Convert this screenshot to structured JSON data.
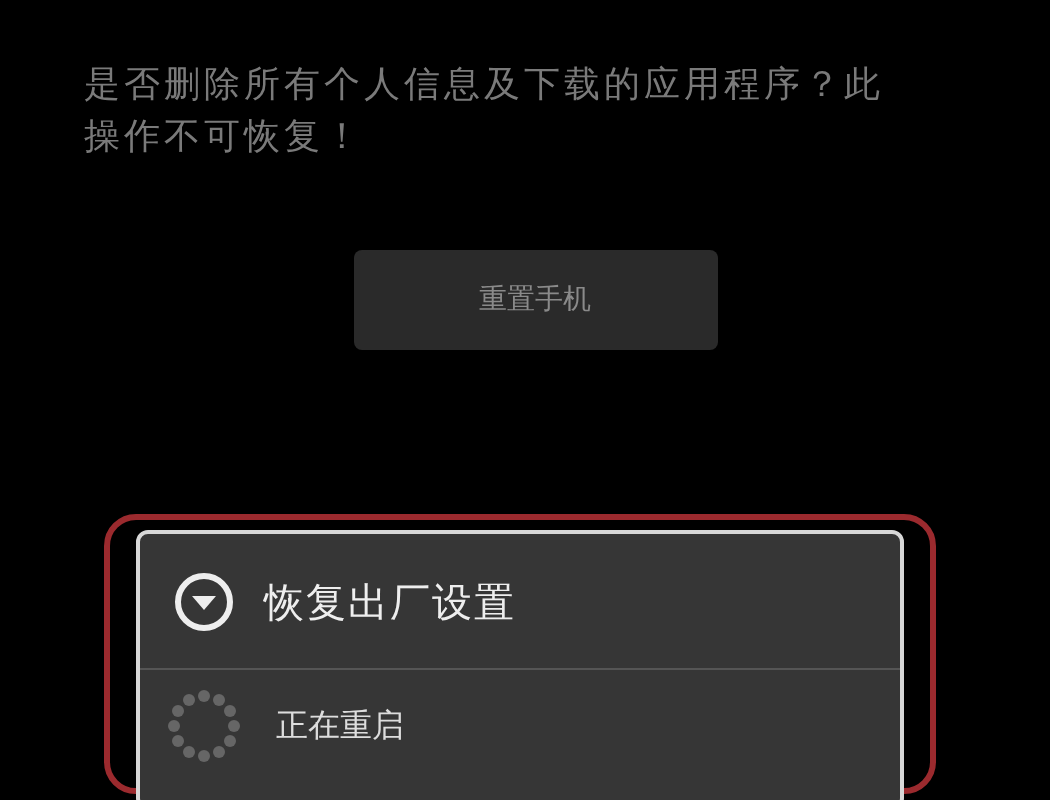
{
  "message": "是否删除所有个人信息及下载的应用程序？此操作不可恢复！",
  "reset_button": {
    "label": "重置手机"
  },
  "dialog": {
    "title": "恢复出厂设置",
    "status": "正在重启"
  }
}
